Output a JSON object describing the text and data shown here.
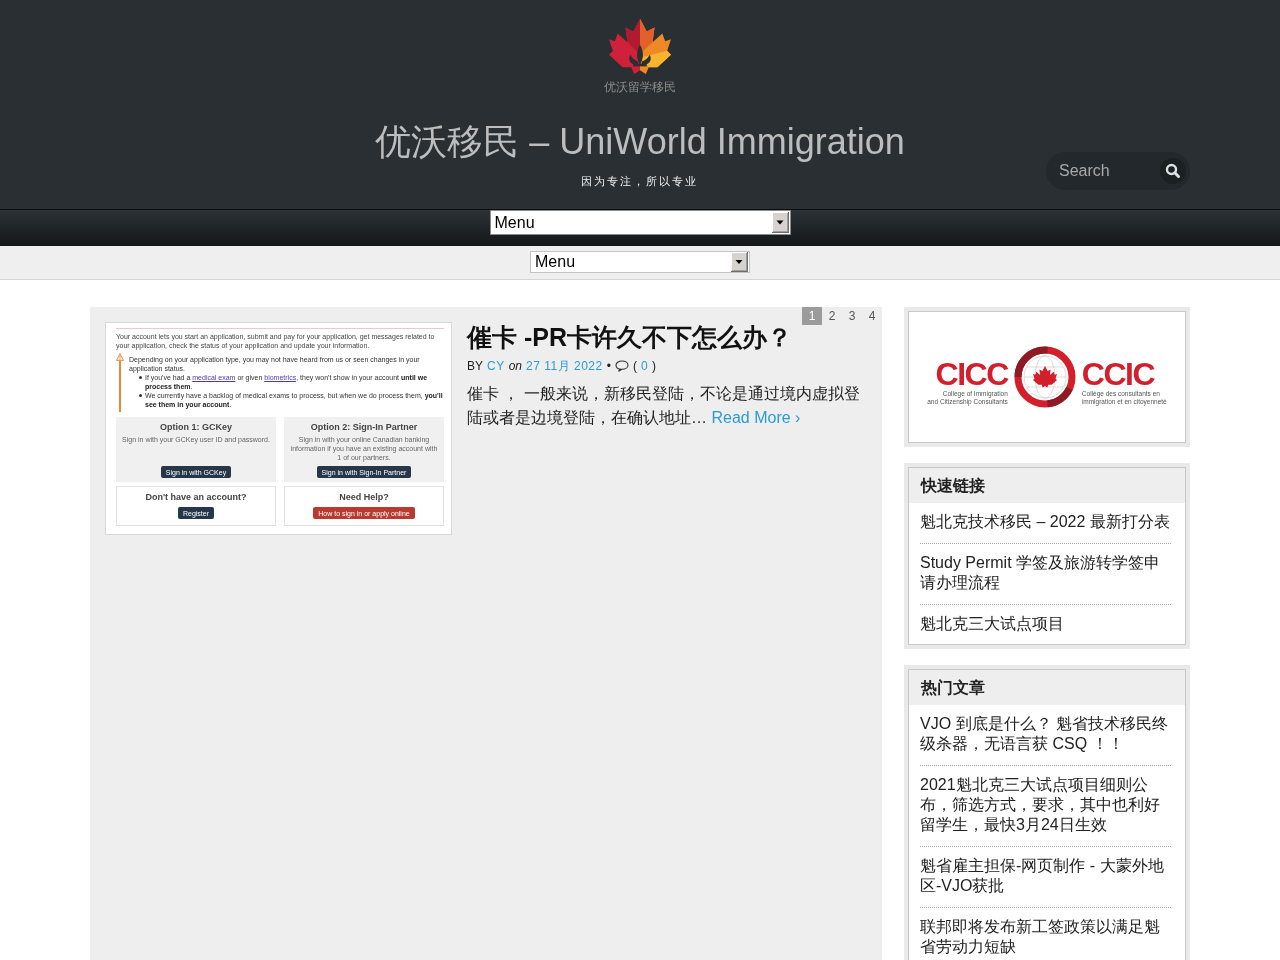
{
  "header": {
    "logo_text": "优沃留学移民",
    "site_title": "优沃移民 – UniWorld Immigration",
    "tagline": "因为专注，所以专业",
    "search": {
      "placeholder": "Search"
    }
  },
  "nav": {
    "primary_menu": "Menu",
    "secondary_menu": "Menu"
  },
  "pagination": [
    {
      "label": "1",
      "selected": true
    },
    {
      "label": "2",
      "selected": false
    },
    {
      "label": "3",
      "selected": false
    },
    {
      "label": "4",
      "selected": false
    }
  ],
  "post": {
    "thumbnail": {
      "intro": "Your account lets you start an application, submit and pay for your application, get messages related to your application, check the status of your application and update your information.",
      "notice": "Depending on your application type, you may not have heard from us or seen changes in your application status.",
      "bullets": [
        {
          "segments": [
            {
              "kind": "text",
              "text": "If you've had a "
            },
            {
              "kind": "link",
              "text": "medical exam"
            },
            {
              "kind": "text",
              "text": " or given "
            },
            {
              "kind": "link",
              "text": "biometrics"
            },
            {
              "kind": "text",
              "text": ", they won't show in your account **until we process them**."
            }
          ]
        },
        {
          "segments": [
            {
              "kind": "text",
              "text": "We currently have a backlog of medical exams to process, but when we do process them, **you'll see them in your account**."
            }
          ]
        }
      ],
      "options": [
        {
          "title": "Option 1: GCKey",
          "text": "Sign in with your GCKey user ID and password.",
          "button": "Sign in with GCKey"
        },
        {
          "title": "Option 2: Sign-In Partner",
          "text": "Sign in with your online Canadian banking information if you have an existing account with 1 of our partners.",
          "button": "Sign in with Sign-In Partner"
        }
      ],
      "help": [
        {
          "title": "Don't have an account?",
          "button": "Register",
          "kind": "primary"
        },
        {
          "title": "Need Help?",
          "button": "How to sign in or apply online",
          "kind": "danger"
        }
      ]
    },
    "title": "催卡 -PR卡许久不下怎么办？",
    "meta": {
      "by": "BY",
      "author": "CY",
      "on": "on",
      "date": "27 11月 2022",
      "separator": "•",
      "count_open": "(",
      "comment_count": "0",
      "count_close": ")"
    },
    "excerpt": "催卡 ， 一般来说，新移民登陆，不论是通过境内虚拟登陆或者是边境登陆，在确认地址…",
    "read_more": "Read More ›"
  },
  "sidebar": {
    "logo_widget": {
      "left_mark": "CICC",
      "left_caption": "College of Immigration\nand Citizenship Consultants",
      "right_mark": "CCIC",
      "right_caption": "Collège des consultants en\nimmigration et en citoyenneté"
    },
    "widgets": [
      {
        "title": "快速链接",
        "items": [
          "魁北克技术移民 – 2022 最新打分表",
          "Study Permit 学签及旅游转学签申请办理流程",
          "魁北克三大试点项目"
        ]
      },
      {
        "title": "热门文章",
        "items": [
          "VJO 到底是什么？ 魁省技术移民终级杀器，无语言获 CSQ ！！",
          "2021魁北克三大试点项目细则公布，筛选方式，要求，其中也利好留学生，最快3月24日生效",
          "魁省雇主担保-网页制作 - 大蒙外地区-VJO获批",
          "联邦即将发布新工签政策以满足魁省劳动力短缺"
        ]
      }
    ]
  }
}
